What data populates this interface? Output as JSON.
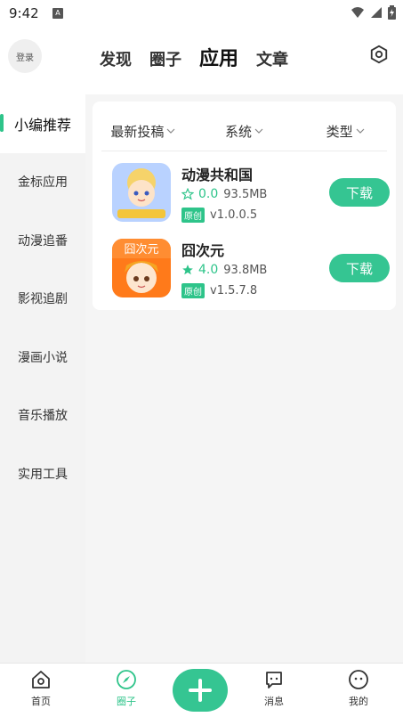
{
  "status": {
    "time": "9:42",
    "badge": "A"
  },
  "header": {
    "login": "登录",
    "tabs": [
      {
        "label": "发现"
      },
      {
        "label": "圈子"
      },
      {
        "label": "应用"
      },
      {
        "label": "文章"
      }
    ],
    "active_tab": "应用"
  },
  "sidebar": {
    "items": [
      {
        "label": "小编推荐"
      },
      {
        "label": "金标应用"
      },
      {
        "label": "动漫追番"
      },
      {
        "label": "影视追剧"
      },
      {
        "label": "漫画小说"
      },
      {
        "label": "音乐播放"
      },
      {
        "label": "实用工具"
      }
    ],
    "active": "小编推荐"
  },
  "filters": [
    {
      "label": "最新投稿"
    },
    {
      "label": "系统"
    },
    {
      "label": "类型"
    }
  ],
  "apps": [
    {
      "name": "动漫共和国",
      "rating": "0.0",
      "size": "93.5MB",
      "badge": "原创",
      "version": "v1.0.0.5",
      "download": "下载",
      "icon_text": "动漫共和国",
      "accent": "#8fb6ff"
    },
    {
      "name": "囧次元",
      "rating": "4.0",
      "size": "93.8MB",
      "badge": "原创",
      "version": "v1.5.7.8",
      "download": "下载",
      "icon_text": "囧次元",
      "accent": "#ff7a1a"
    }
  ],
  "bottom_nav": {
    "home": "首页",
    "circle": "圈子",
    "messages": "消息",
    "me": "我的"
  },
  "colors": {
    "accent": "#2ec48a",
    "button": "#35c592"
  }
}
